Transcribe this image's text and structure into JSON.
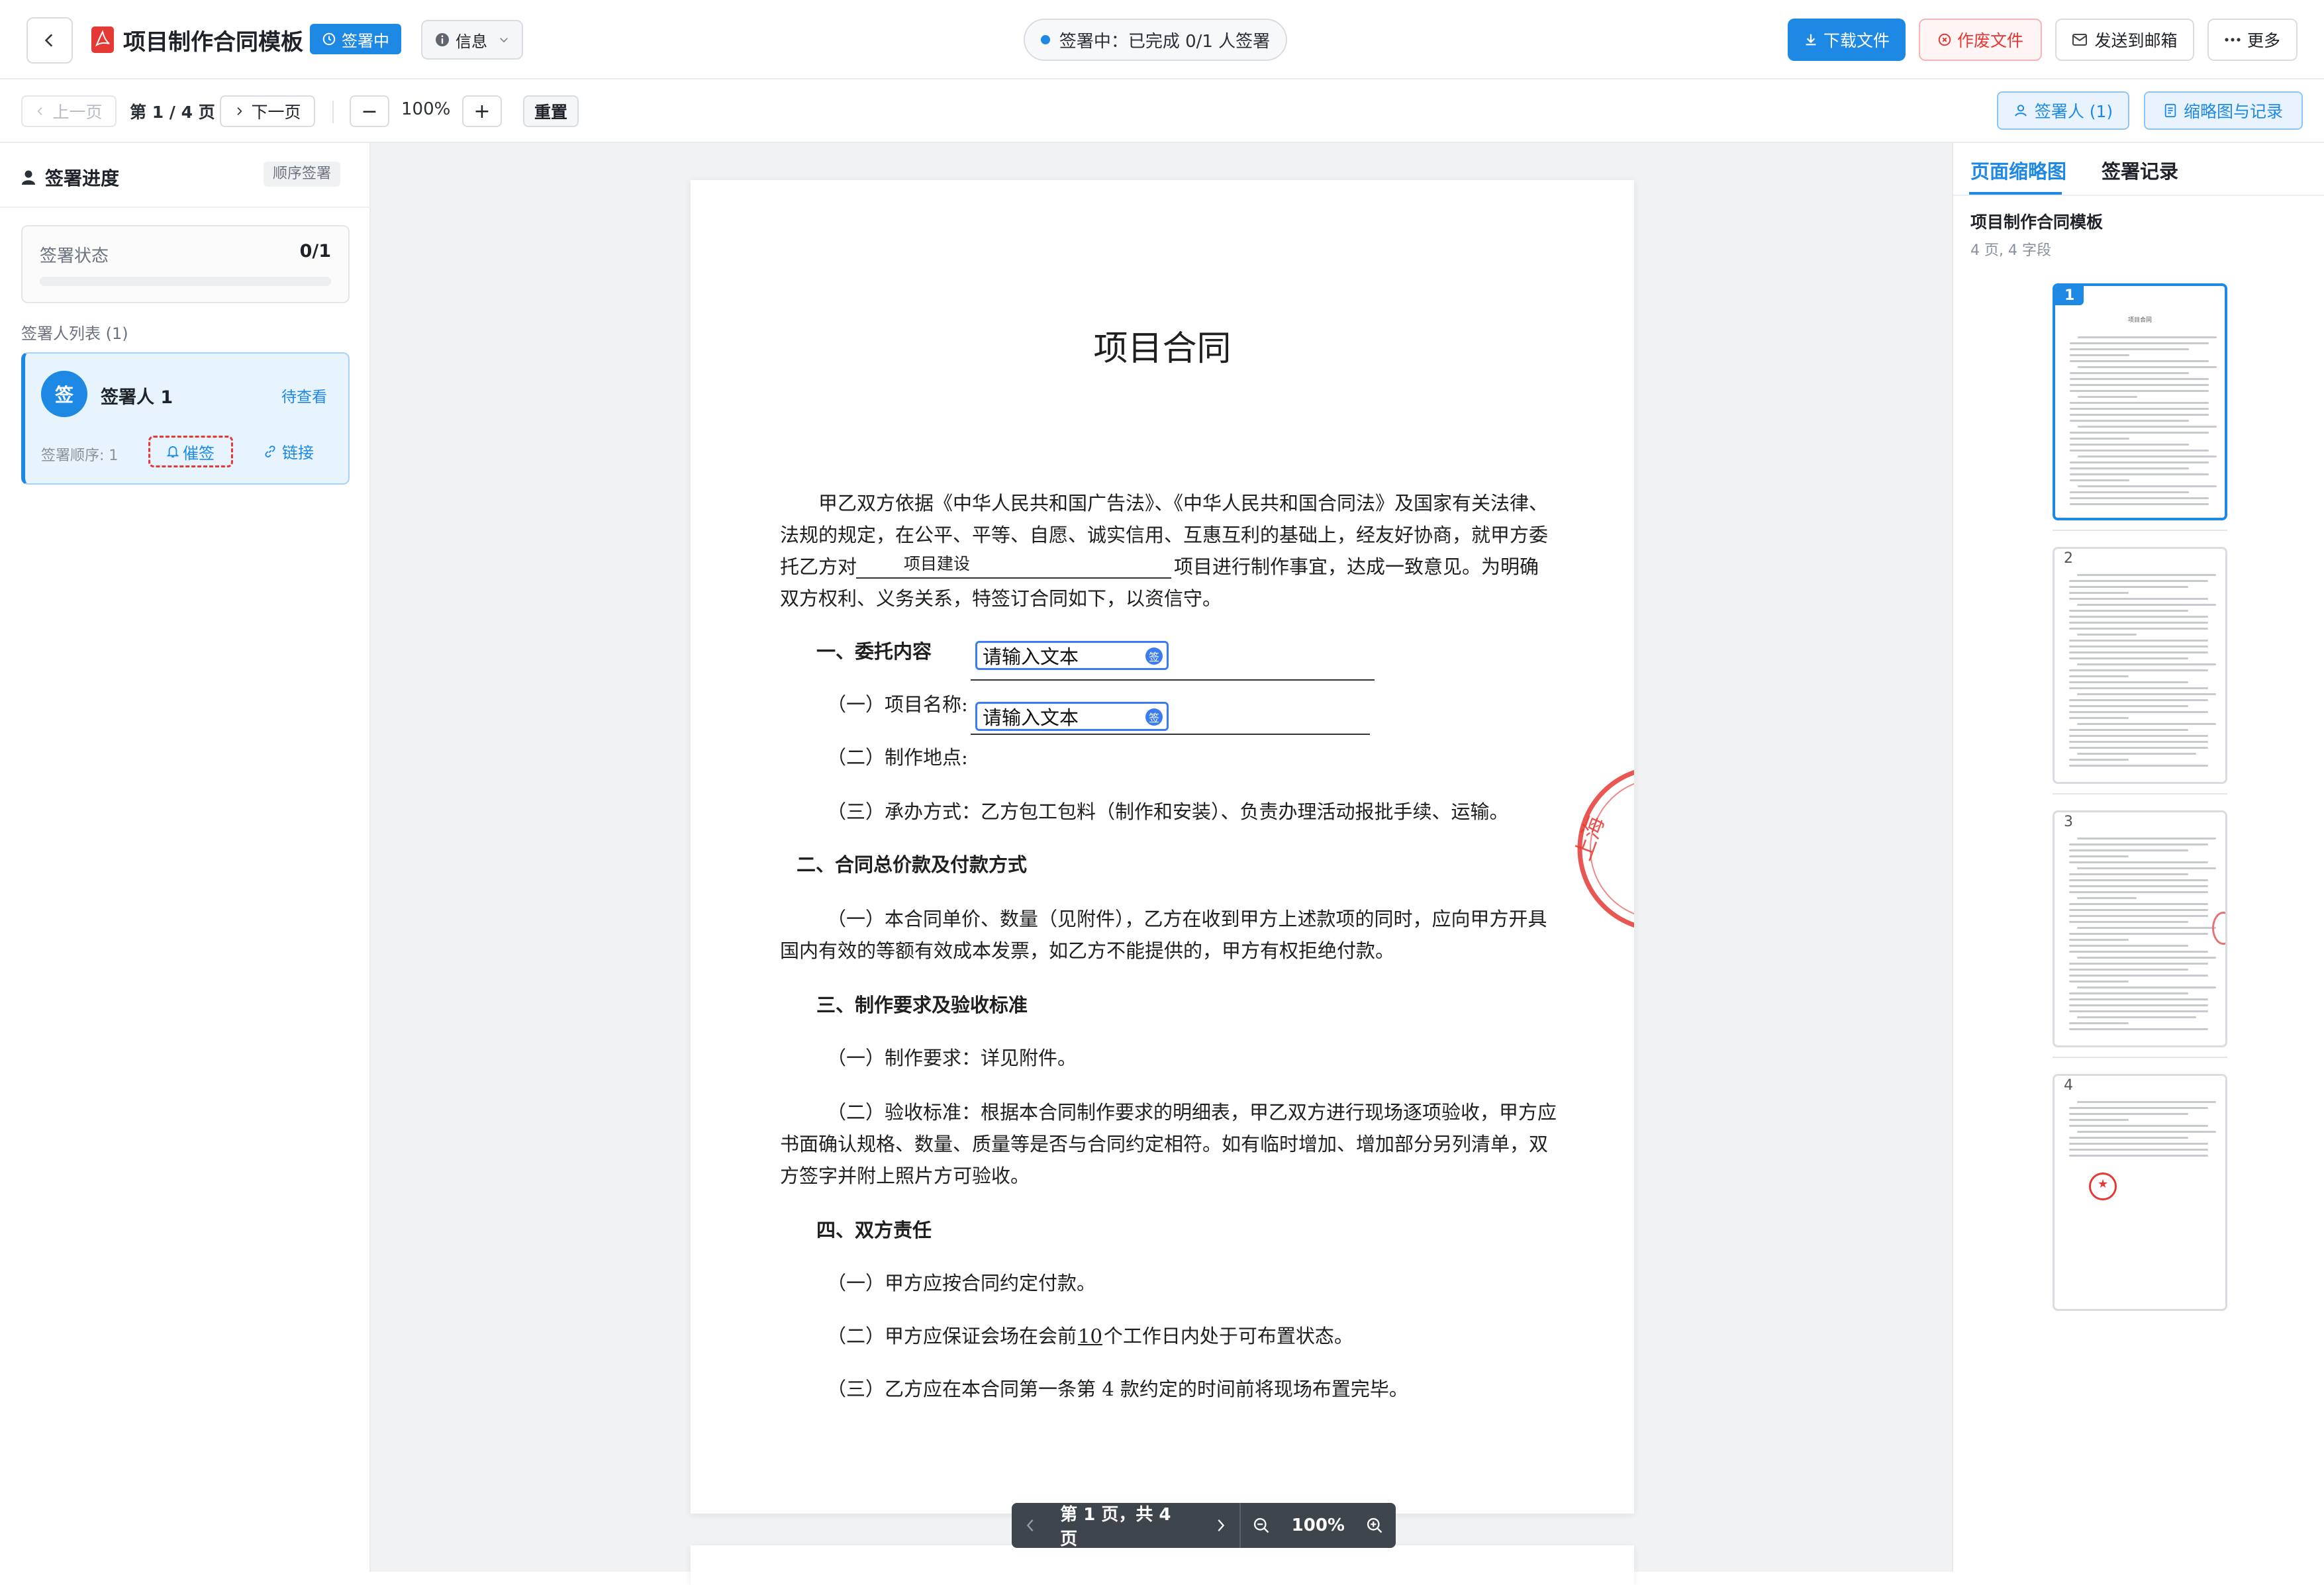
{
  "header": {
    "back_label": "",
    "title": "项目制作合同模板",
    "status_badge": "签署中",
    "info_label": "信息",
    "center_status": "签署中：已完成 0/1 人签署",
    "download_label": "下载文件",
    "void_label": "作废文件",
    "email_label": "发送到邮箱",
    "more_label": "更多"
  },
  "toolbar": {
    "prev_label": "上一页",
    "page_indicator": "第 1 / 4 页",
    "next_label": "下一页",
    "zoom_out": "−",
    "zoom_value": "100%",
    "zoom_in": "+",
    "reset_label": "重置",
    "signers_label": "签署人 (1)",
    "thumbs_label": "缩略图与记录"
  },
  "left": {
    "title": "签署进度",
    "order_badge": "顺序签署",
    "status_label": "签署状态",
    "status_value": "0/1",
    "progress": 0,
    "list_title": "签署人列表 (1)",
    "signer": {
      "avatar": "签",
      "name": "签署人 1",
      "state": "待查看",
      "order": "签署顺序: 1",
      "remind": "催签",
      "link": "链接"
    }
  },
  "document": {
    "title": "项目合同",
    "intro_lines": [
      "甲乙双方依据《中华人民共和国广告法》、《中华人民共和国合同法》及国家有关法律、",
      "法规的规定，在公平、平等、自愿、诚实信用、互惠互利的基础上，经友好协商，就甲方委",
      "托乙方对",
      "项目进行制作事宜，达成一致意见。为明确",
      "双方权利、义务关系，特签订合同如下，以资信守。"
    ],
    "project_fill": "项目建设",
    "s1": "一、委托内容",
    "s1_1": "（一）项目名称:",
    "s1_2": "（二）制作地点:",
    "s1_3": "（三）承办方式：乙方包工包料（制作和安装）、负责办理活动报批手续、运输。",
    "field_placeholder": "请输入文本",
    "field_icon": "签",
    "s2": "二、合同总价款及付款方式",
    "s2_lines": [
      "（一）本合同单价、数量（见附件），乙方在收到甲方上述款项的同时，应向甲方开具",
      "国内有效的等额有效成本发票，如乙方不能提供的，甲方有权拒绝付款。"
    ],
    "s3": "三、制作要求及验收标准",
    "s3_1": "（一）制作要求：详见附件。",
    "s3_2_lines": [
      "（二）验收标准：根据本合同制作要求的明细表，甲乙双方进行现场逐项验收，甲方应",
      "书面确认规格、数量、质量等是否与合同约定相符。如有临时增加、增加部分另列清单，双",
      "方签字并附上照片方可验收。"
    ],
    "s4": "四、双方责任",
    "s4_1": "（一）甲方应按合同约定付款。",
    "s4_2a": "（二）甲方应保证会场在会前",
    "s4_2num": "10",
    "s4_2b": "个工作日内处于可布置状态。",
    "s4_3": "（三）乙方应在本合同第一条第 4 款约定的时间前将现场布置完毕。",
    "seal_text": "上海"
  },
  "floatbar": {
    "page_text": "第 1 页，共 4 页",
    "zoom": "100%"
  },
  "right": {
    "tab_thumbs": "页面缩略图",
    "tab_records": "签署记录",
    "doc_title": "项目制作合同模板",
    "doc_meta": "4 页, 4 字段",
    "pages": [
      "1",
      "2",
      "3",
      "4"
    ],
    "thumb_title": "项目合同"
  },
  "colors": {
    "primary": "#1e88e5",
    "danger": "#e53935",
    "seal": "#e53935"
  }
}
